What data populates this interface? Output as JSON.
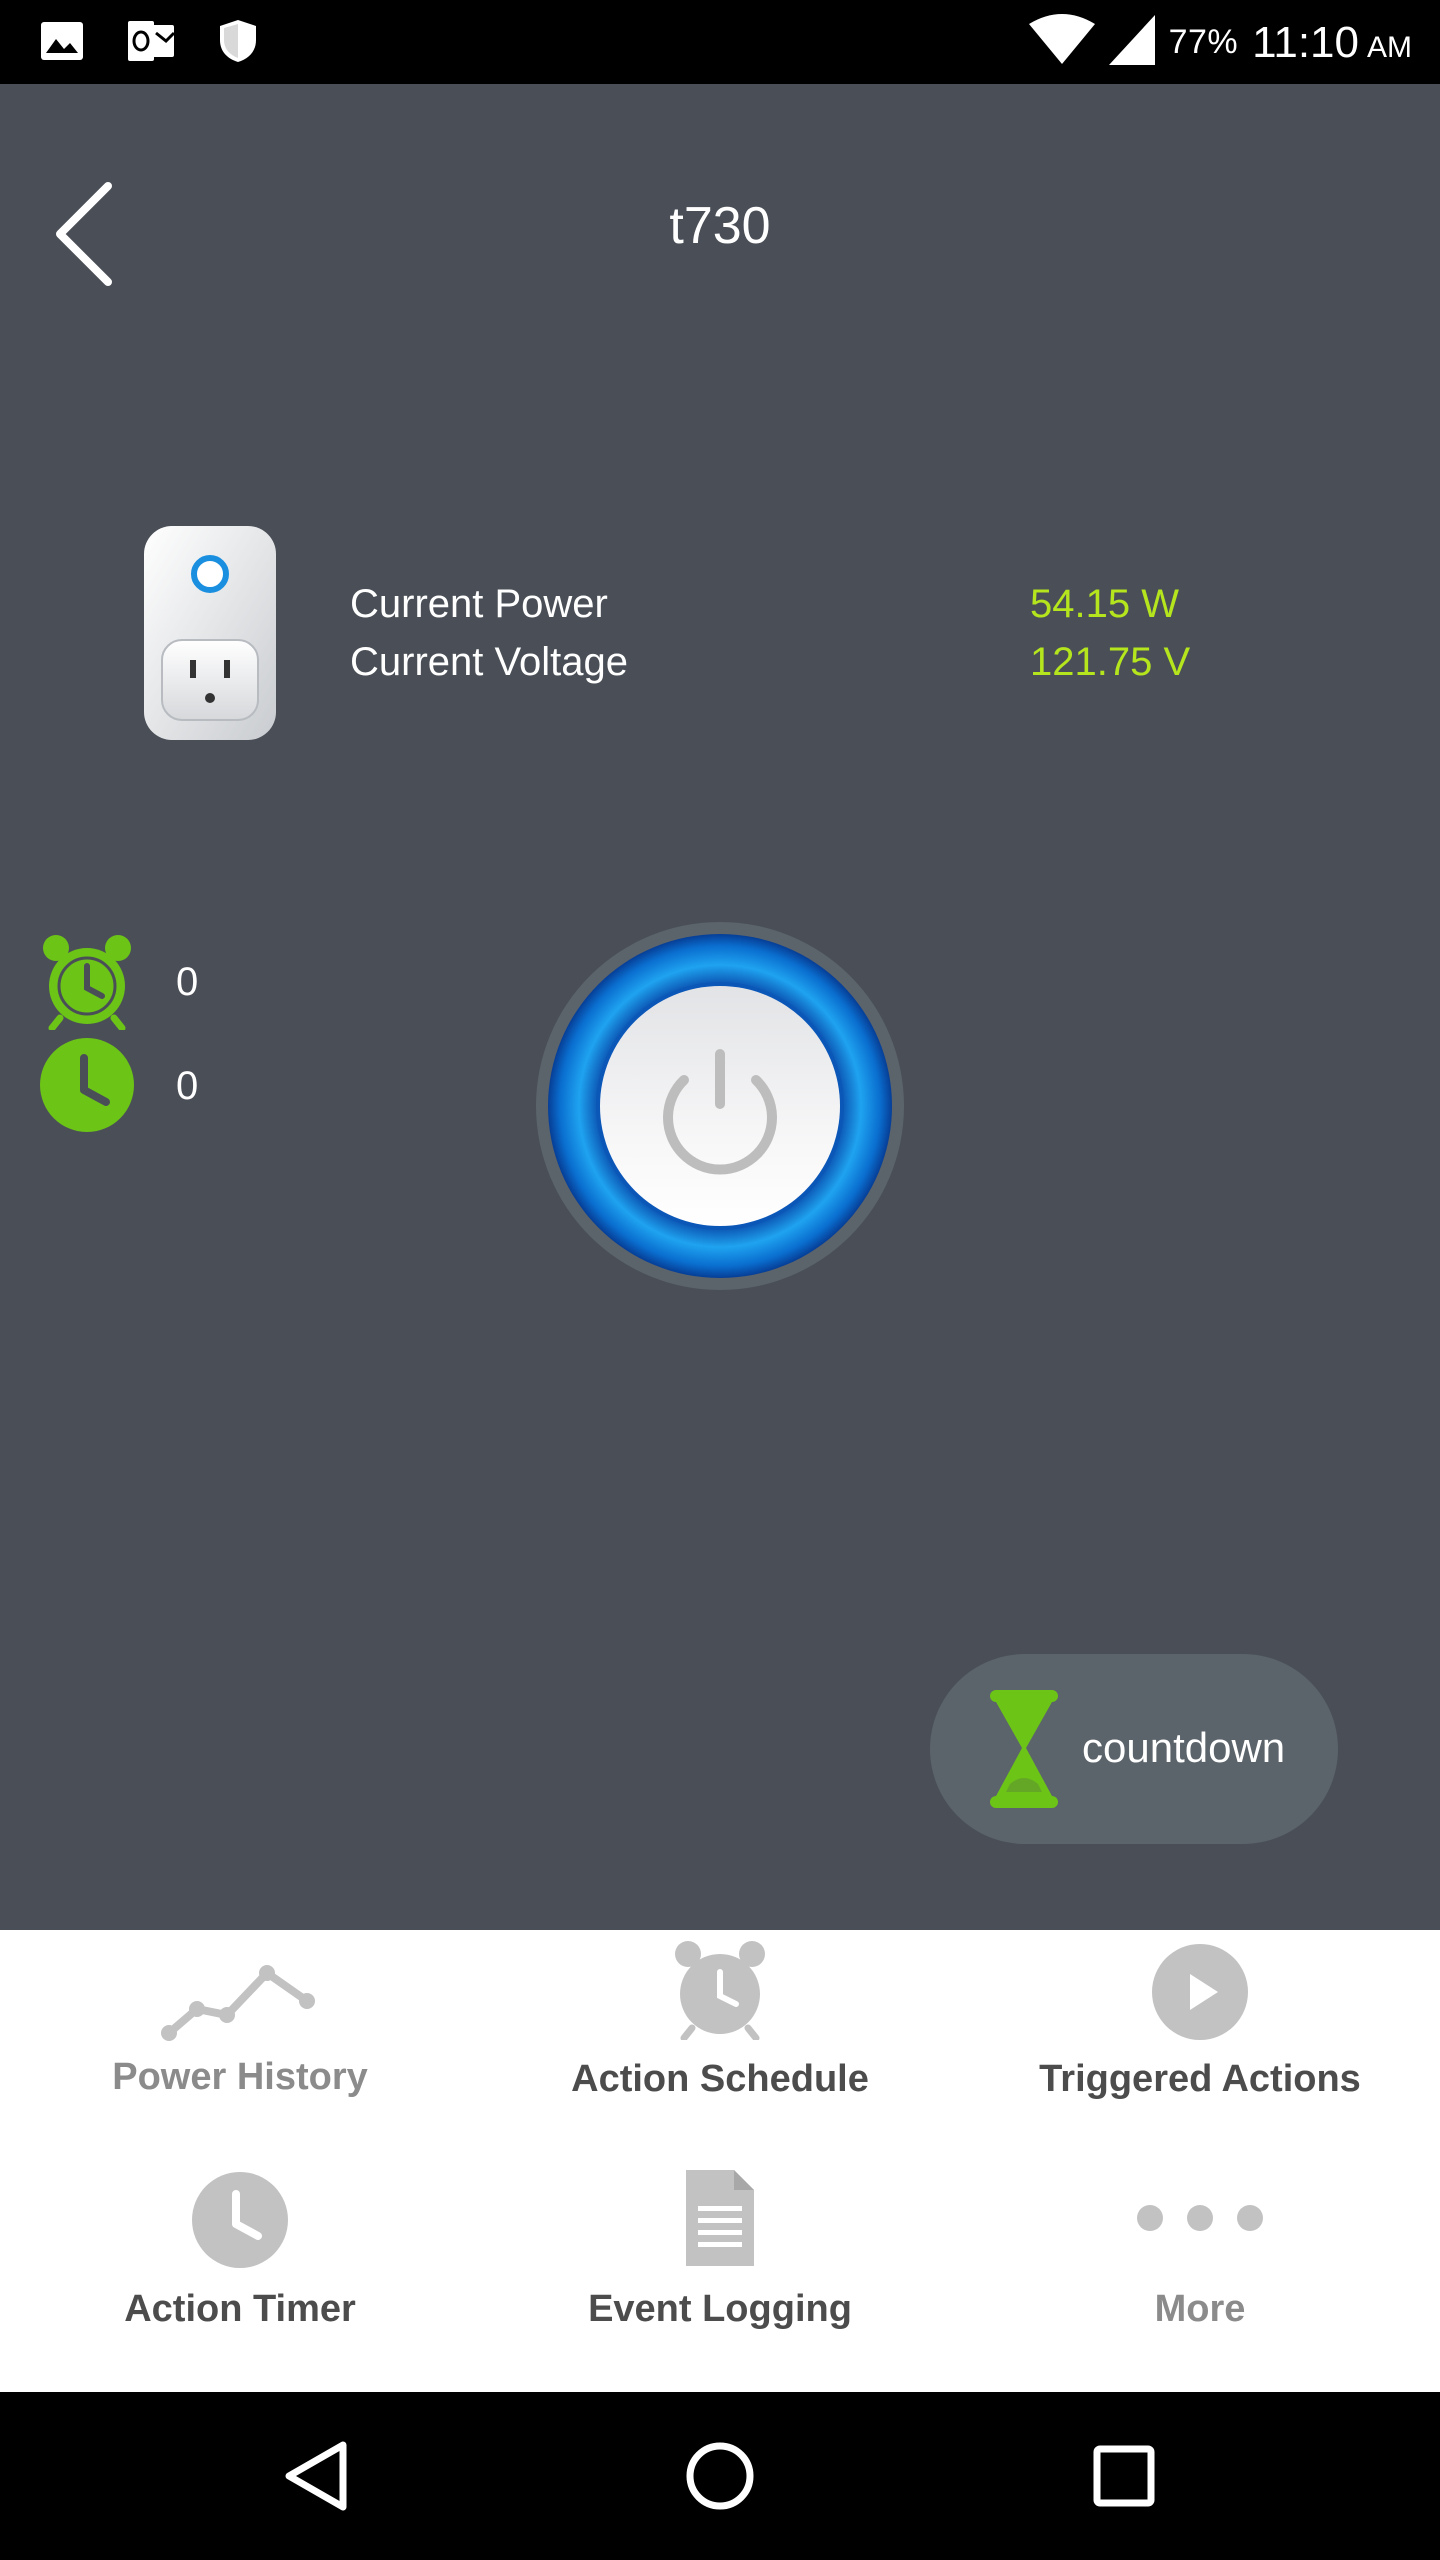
{
  "status_bar": {
    "battery": "77%",
    "time": "11:10",
    "ampm": "AM",
    "icons": [
      "image-icon",
      "outlook-icon",
      "shield-icon",
      "wifi-icon",
      "signal-icon"
    ]
  },
  "header": {
    "title": "t730",
    "back_icon": "chevron-left-icon"
  },
  "device": {
    "image": "smart-plug-image",
    "power_label": "Current Power",
    "power_value": "54.15 W",
    "voltage_label": "Current Voltage",
    "voltage_value": "121.75 V"
  },
  "counters": {
    "schedule_count": "0",
    "timer_count": "0"
  },
  "power_button": {
    "icon": "power-icon",
    "state": "on"
  },
  "countdown": {
    "label": "countdown",
    "icon": "hourglass-icon"
  },
  "menu": {
    "items": [
      {
        "label": "Power History",
        "icon": "line-chart-icon"
      },
      {
        "label": "Action Schedule",
        "icon": "alarm-clock-icon"
      },
      {
        "label": "Triggered Actions",
        "icon": "play-icon"
      },
      {
        "label": "Action Timer",
        "icon": "clock-icon"
      },
      {
        "label": "Event Logging",
        "icon": "document-icon"
      },
      {
        "label": "More",
        "icon": "more-dots-icon"
      }
    ]
  },
  "nav": {
    "back": "nav-back-icon",
    "home": "nav-home-icon",
    "recents": "nav-recents-icon"
  },
  "colors": {
    "background": "#4a4f57",
    "accent_green": "#b5e61d",
    "icon_green": "#6cc417",
    "button_blue": "#1a8fe0"
  }
}
